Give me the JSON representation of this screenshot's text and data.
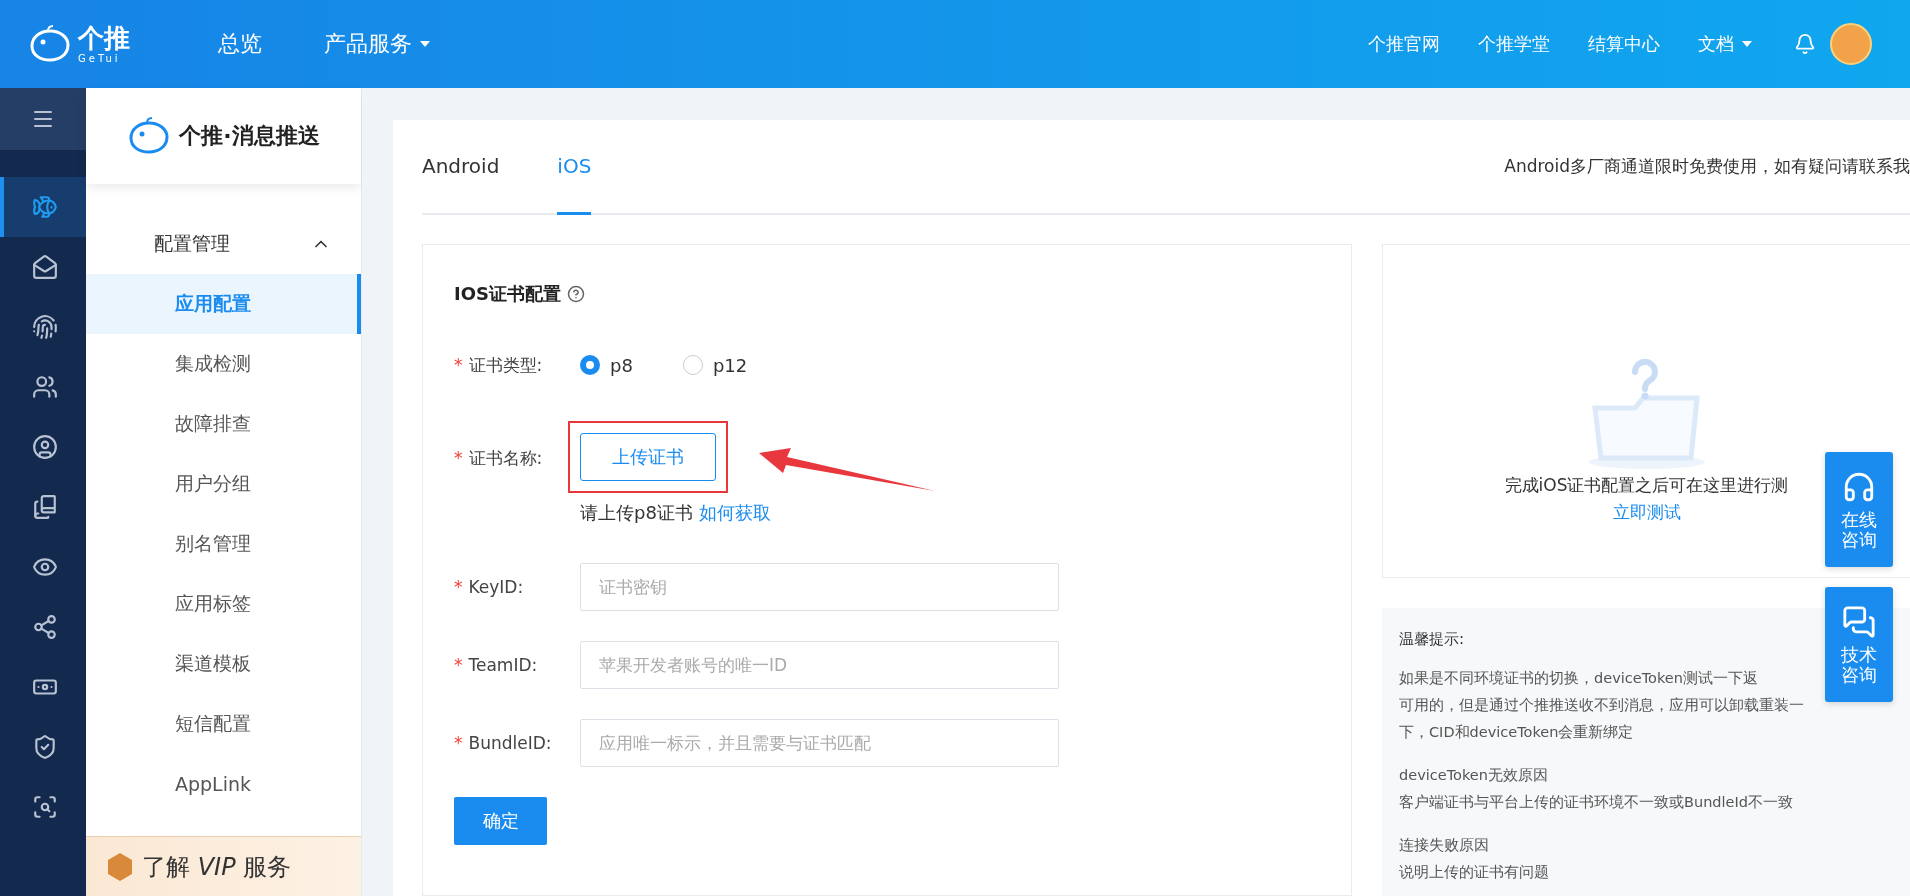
{
  "topbar": {
    "logo_text": "个推",
    "logo_subtext": "GeTui",
    "nav": [
      {
        "label": "总览",
        "dropdown": false
      },
      {
        "label": "产品服务",
        "dropdown": true
      }
    ],
    "links": [
      {
        "label": "个推官网",
        "dropdown": false
      },
      {
        "label": "个推学堂",
        "dropdown": false
      },
      {
        "label": "结算中心",
        "dropdown": false
      },
      {
        "label": "文档",
        "dropdown": true
      }
    ]
  },
  "rail_items": [
    {
      "selected": true
    },
    {
      "selected": false
    },
    {
      "selected": false
    },
    {
      "selected": false
    },
    {
      "selected": false
    },
    {
      "selected": false
    },
    {
      "selected": false
    },
    {
      "selected": false
    },
    {
      "selected": false
    },
    {
      "selected": false
    },
    {
      "selected": false
    }
  ],
  "sidebar": {
    "title": "个推·消息推送",
    "group": {
      "label": "配置管理",
      "expanded": true,
      "items": [
        {
          "label": "应用配置",
          "selected": true
        },
        {
          "label": "集成检测",
          "selected": false
        },
        {
          "label": "故障排查",
          "selected": false
        },
        {
          "label": "用户分组",
          "selected": false
        },
        {
          "label": "别名管理",
          "selected": false
        },
        {
          "label": "应用标签",
          "selected": false
        },
        {
          "label": "渠道模板",
          "selected": false
        },
        {
          "label": "短信配置",
          "selected": false
        },
        {
          "label": "AppLink",
          "selected": false
        }
      ]
    },
    "vip_banner": "了解 *VIP* 服务"
  },
  "tabs": [
    {
      "label": "Android",
      "selected": false
    },
    {
      "label": "iOS",
      "selected": true
    }
  ],
  "notice": "Android多厂商通道限时免费使用，如有疑问请联系我",
  "form": {
    "title": "IOS证书配置",
    "fields": [
      {
        "kind": "radio",
        "mark": "*",
        "label": "证书类型:",
        "options": [
          {
            "label": "p8",
            "selected": true
          },
          {
            "label": "p12",
            "selected": false
          }
        ]
      },
      {
        "kind": "upload",
        "mark": "*",
        "label": "证书名称:",
        "button": "上传证书",
        "hint": "请上传p8证书",
        "link": "如何获取",
        "highlighted": true
      },
      {
        "kind": "input",
        "mark": "*",
        "label": "KeyID:",
        "placeholder": "证书密钥"
      },
      {
        "kind": "input",
        "mark": "*",
        "label": "TeamID:",
        "placeholder": "苹果开发者账号的唯一ID"
      },
      {
        "kind": "input",
        "mark": "*",
        "label": "BundleID:",
        "placeholder": "应用唯一标示，并且需要与证书匹配"
      }
    ],
    "submit": "确定"
  },
  "test_card": {
    "message": "完成iOS证书配置之后可在这里进行测",
    "link": "立即测试"
  },
  "tips": {
    "title": "温馨提示:",
    "sections": [
      {
        "lines": [
          "如果是不同环境证书的切换，deviceToken测试一下返",
          "可用的，但是通过个推推送收不到消息，应用可以卸载重装一",
          "下，CID和deviceToken会重新绑定"
        ]
      },
      {
        "lines": [
          "deviceToken无效原因",
          "客户端证书与平台上传的证书环境不一致或BundleId不一致"
        ]
      },
      {
        "lines": [
          "连接失败原因",
          "说明上传的证书有问题"
        ]
      }
    ]
  },
  "float_buttons": [
    {
      "kind": "chat",
      "label": "在线咨询"
    },
    {
      "kind": "wechat",
      "label": "技术咨询"
    }
  ]
}
